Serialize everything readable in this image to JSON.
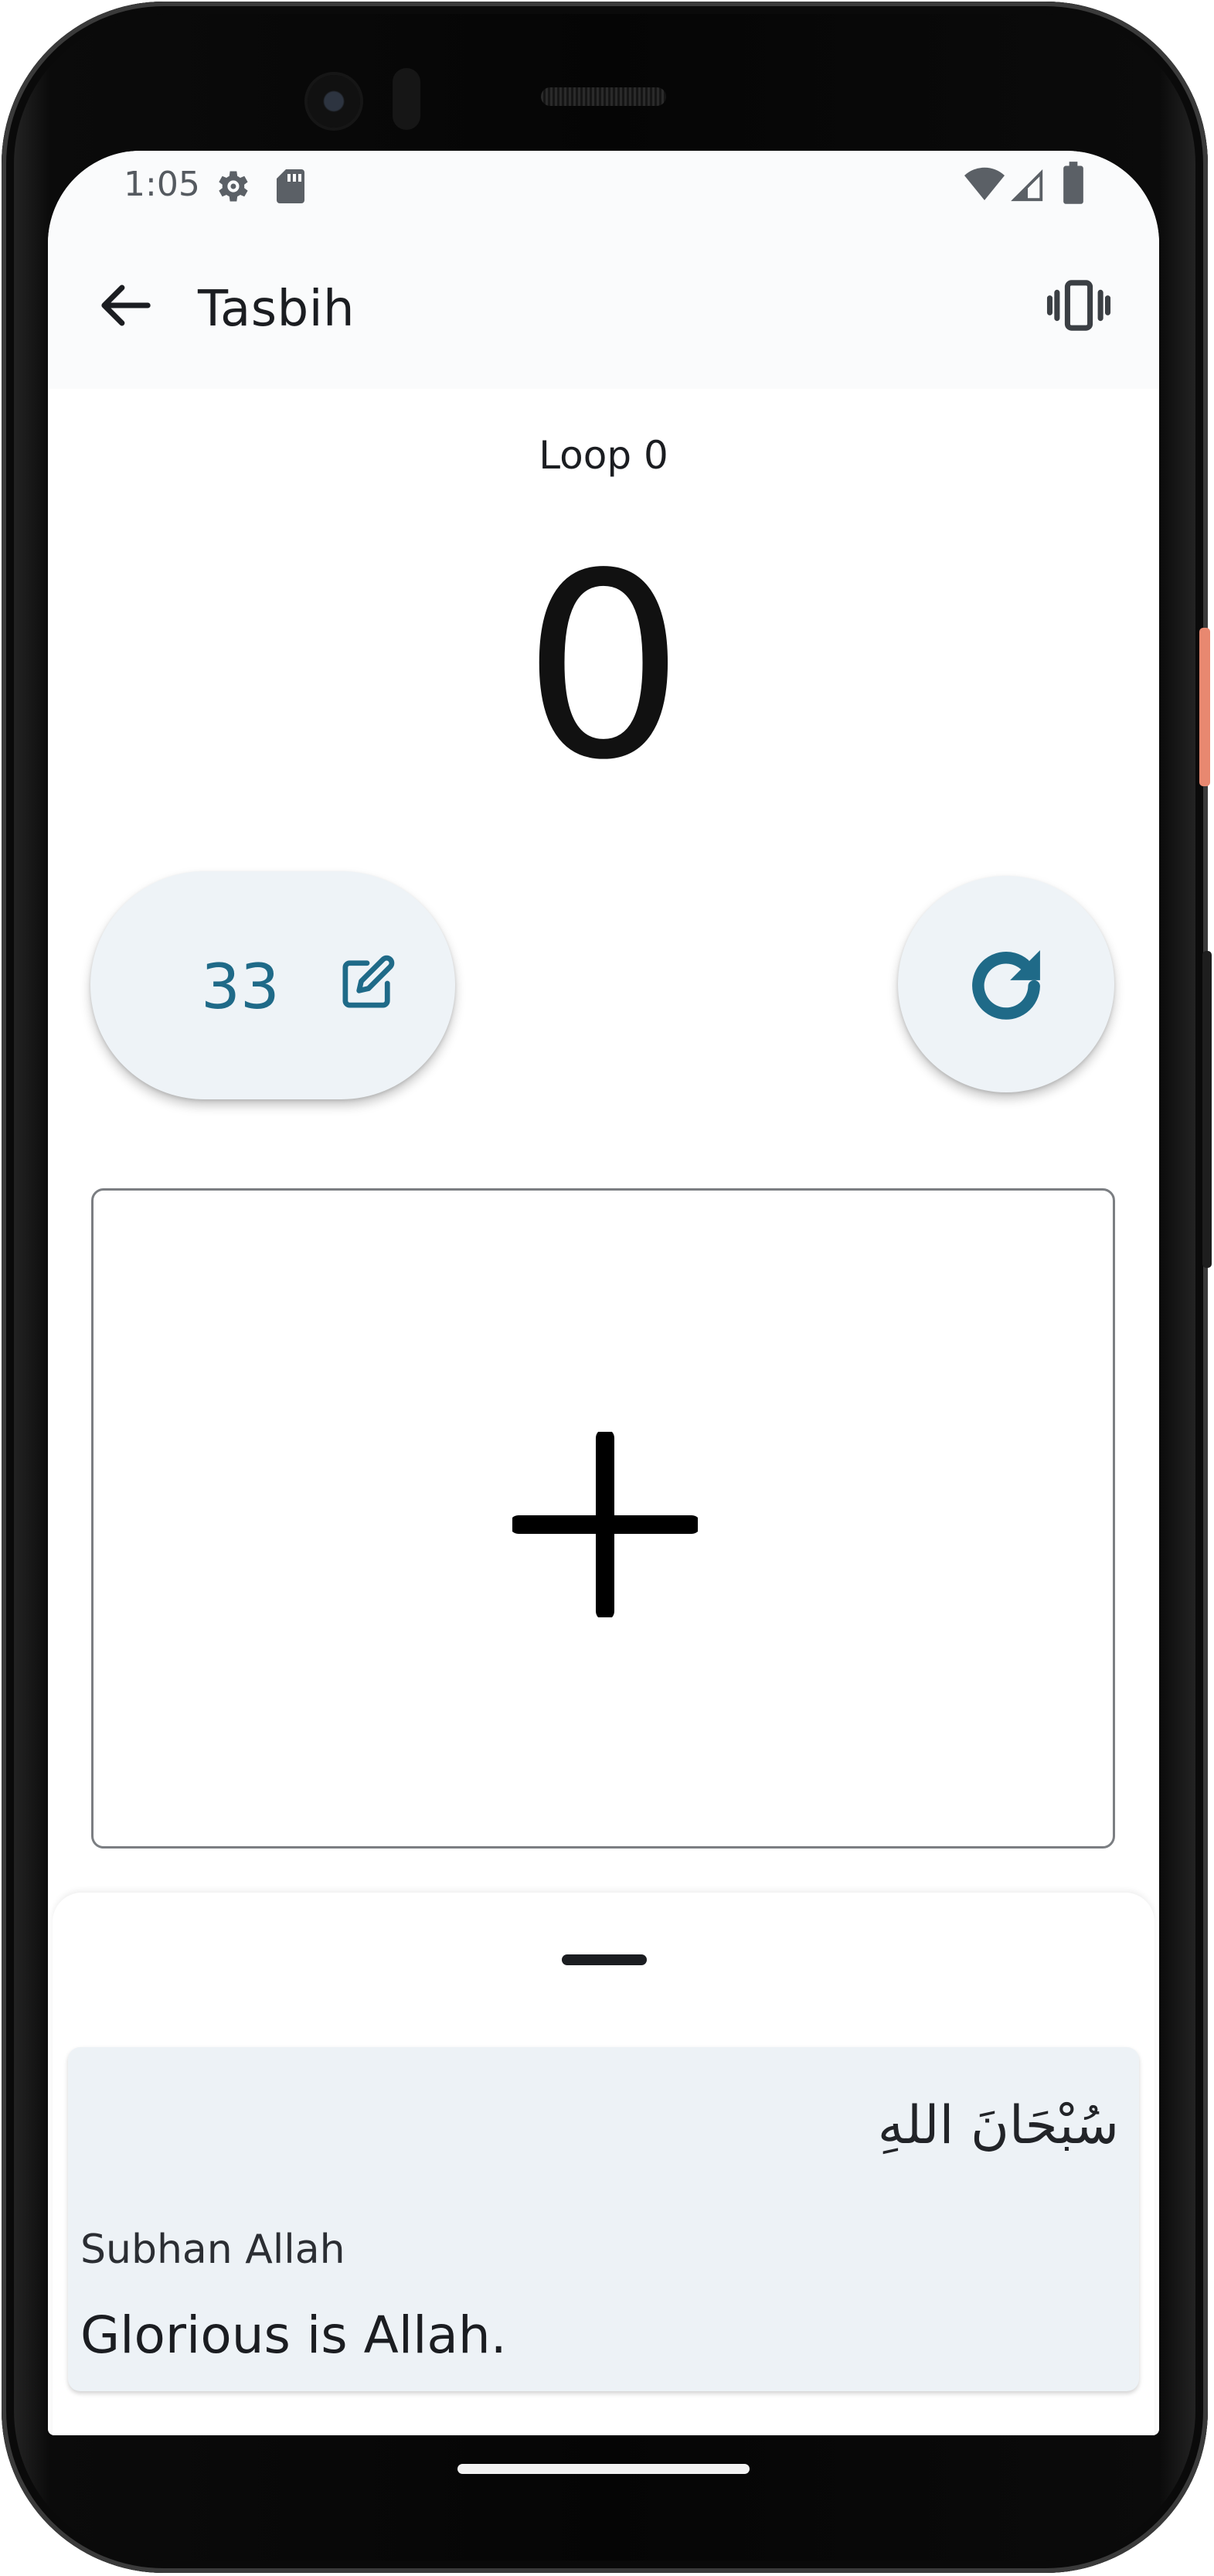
{
  "status_bar": {
    "time": "1:05",
    "icons": [
      "settings-icon",
      "sd-card-icon",
      "wifi-icon",
      "signal-icon",
      "battery-icon"
    ]
  },
  "app_bar": {
    "back_icon": "arrow-back-icon",
    "title": "Tasbih",
    "vibration_icon": "vibration-icon"
  },
  "counter": {
    "loop_label": "Loop 0",
    "count": "0",
    "target": "33",
    "target_edit_icon": "edit-icon",
    "reset_icon": "refresh-icon",
    "increment_icon": "plus-icon"
  },
  "dhikr": {
    "arabic": "سُبْحَانَ اللهِ",
    "transliteration": "Subhan Allah",
    "translation": "Glorious is Allah."
  },
  "colors": {
    "accent": "#1f6a88",
    "button_surface": "#eef3f7",
    "card_surface": "#edf2f6",
    "text": "#1b1d21"
  }
}
